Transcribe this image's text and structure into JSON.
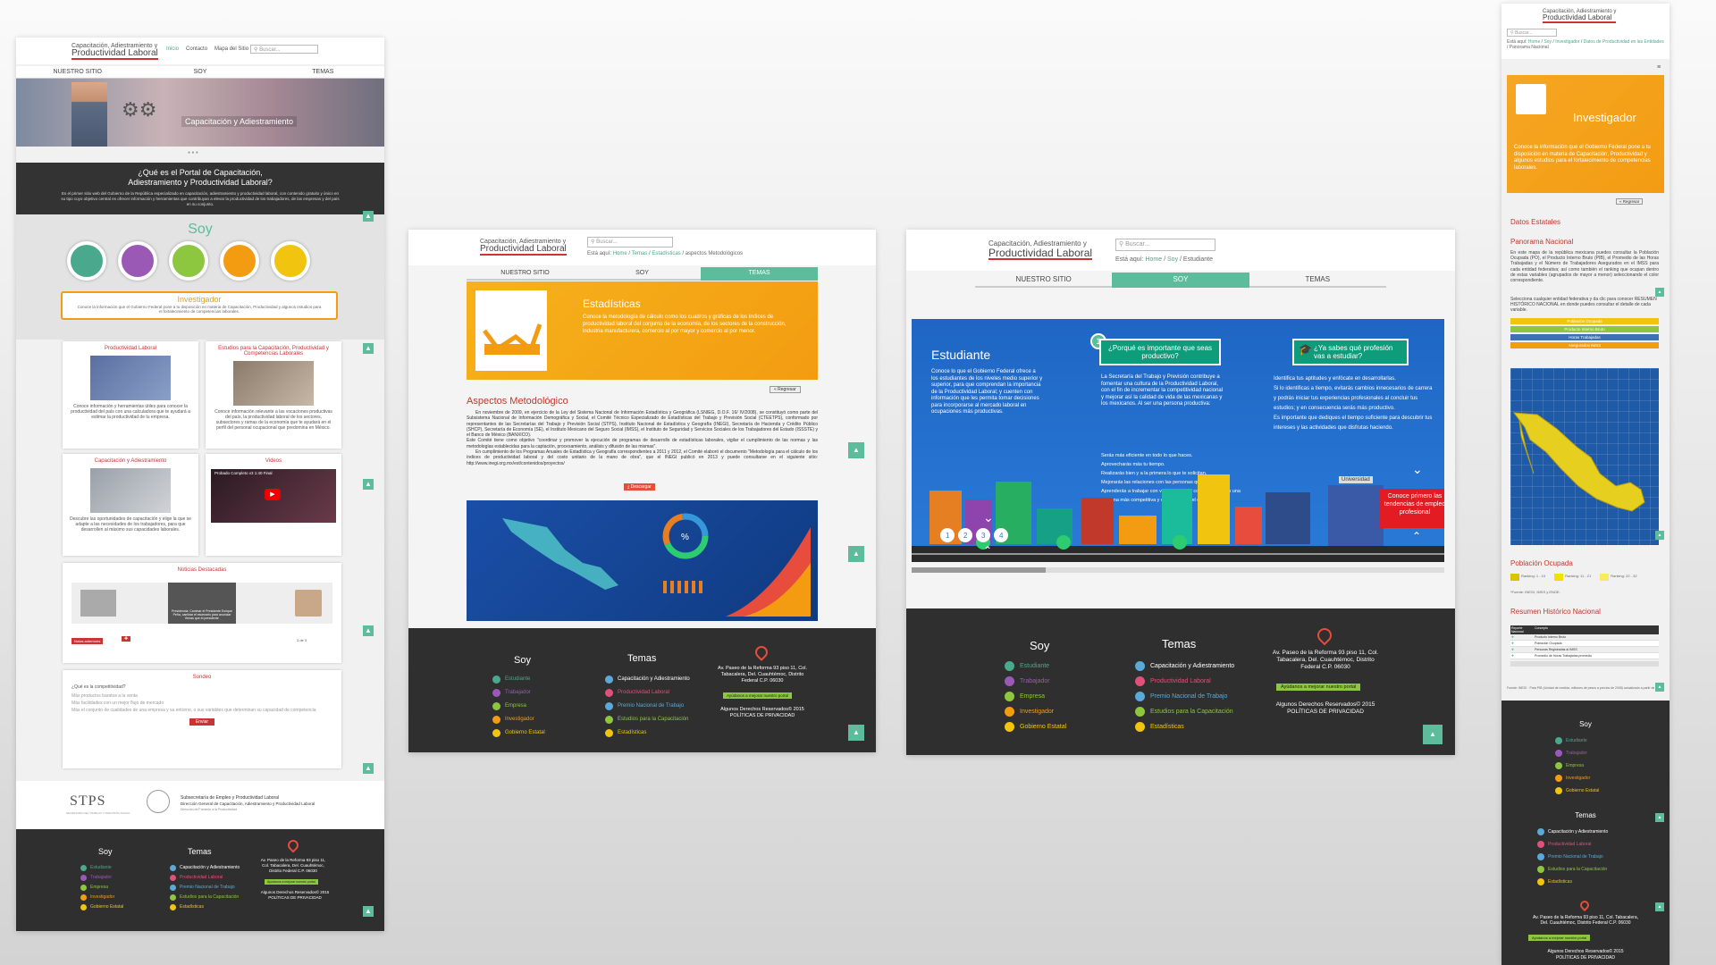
{
  "logo": {
    "line1": "Capacitación, Adiestramiento y",
    "line2": "Productividad Laboral"
  },
  "search_placeholder": "Buscar...",
  "top_nav": [
    "Inicio",
    "Contacto",
    "Mapa del Sitio"
  ],
  "tabs": {
    "home": "NUESTRO SITIO",
    "soy": "SOY",
    "temas": "TEMAS"
  },
  "breadcrumb_label": "Está aquí:",
  "m1": {
    "hero_caption": "Capacitación y Adiestramiento",
    "question_title": "¿Qué es el Portal de Capacitación, Adiestramiento y Productividad Laboral?",
    "question_body": "Es el primer sitio web del Gobierno de la República especializado en capacitación, adiestramiento y productividad laboral, con contenido gratuito y único en su tipo cuyo objetivo central es ofrecer información y herramientas que contribuyan a elevar la productividad de los trabajadores, de las empresas y del país en su conjunto.",
    "soy_title": "Soy",
    "soy_circles": [
      {
        "color": "#4aa88d"
      },
      {
        "color": "#9b59b6"
      },
      {
        "color": "#8dc63f"
      },
      {
        "color": "#f39c12"
      },
      {
        "color": "#f1c40f"
      }
    ],
    "profile_title": "Investigador",
    "profile_desc": "Conoce la información que el Gobierno Federal pone a tu disposición en materia de Capacitación, Productividad y algunos estudios para el fortalecimiento de competencias laborales.",
    "cards": [
      {
        "title": "Productividad Laboral",
        "desc": "Conoce información y herramientas útiles para conocer la productividad del país con una calculadora que te ayudará a estimar la productividad de tu empresa."
      },
      {
        "title": "Estudios para la Capacitación, Productividad y Competencias Laborales",
        "desc": "Conoce información relevante a las vocaciones productivas del país, la productividad laboral de los sectores, subsectores y ramas de la economía que te ayudará en el perfil del personal ocupacional que predomina en México."
      },
      {
        "title": "Capacitación y Adiestramiento",
        "desc": "Descubre las oportunidades de capacitación y elige la que se adapte a las necesidades de los trabajadores, para que desarrollen al máximo sus capacidades laborales."
      },
      {
        "title": "Videos",
        "desc": "",
        "video_title": "Probado Completo v3 1:40 Final"
      }
    ],
    "news_title": "Noticias Destacadas",
    "news_more": "Notas anteriores",
    "news_counter": "3 de 3",
    "news_caption": "Presidencia: Caminar el Presidente Enrique Peña, cambiar el escenario para anunciar firmas que el presidente",
    "survey_title": "Sondeo",
    "survey_q": "¿Qué es la competitividad?",
    "survey_opts": [
      "Más productos baratos a la venta",
      "Más facilidades con un mejor flujo de mercado",
      "Más el conjunto de cualidades de una empresa y su entorno, o sus variables que determinan su capacidad de competencia"
    ],
    "survey_btn": "Enviar",
    "stps": "STPS",
    "stps_sub": "SECRETARÍA DEL TRABAJO Y PREVISIÓN SOCIAL",
    "org1": "Subsecretaría de Empleo y Productividad Laboral",
    "org2": "Dirección General de Capacitación, Adiestramiento y Productividad Laboral",
    "org3": "Dirección de Fomento a la Productividad"
  },
  "m2": {
    "breadcrumb": [
      "Home",
      "Temas",
      "Estadísticas",
      "aspectos Metodológicos"
    ],
    "banner_title": "Estadísticas",
    "banner_desc": "Conoce la metodología de cálculo como los cuadros y gráficas de los índices de productividad laboral del conjunto de la economía, de los sectores de la construcción, industria manufacturera, comercio al por mayor y comercio al por menor.",
    "regresar": "« Regresar",
    "section_title": "Aspectos Metodológico",
    "p1": "En noviembre de 2009, en ejercicio de la Ley del Sistema Nacional de Información Estadística y Geográfica (LSNIEG, D.O.F. 16/ IV/2008), se constituyó como parte del Subsistema Nacional de Información Demográfica y Social, el Comité Técnico Especializado de Estadísticas del Trabajo y Previsión Social (CTEETPS), conformado por representantes de las Secretarías del Trabajo y Previsión Social (STPS), Instituto Nacional de Estadística y Geografía (INEGI), Secretaría de Hacienda y Crédito Público (SHCP), Secretaría de Economía (SE), el Instituto Mexicano del Seguro Social (IMSS), el Instituto de Seguridad y Servicios Sociales de los Trabajadores del Estado (ISSSTE) y el Banco de México (BANXICO).",
    "p2": "Este Comité tiene como objetivo \"coordinar y promover la ejecución de programas de desarrollo de estadísticas laborales, vigilar el cumplimiento de las normas y las metodologías establecidas para la captación, procesamiento, análisis y difusión de las mismas\".",
    "p3": "En cumplimiento de los Programas Anuales de Estadística y Geografía correspondientes a 2011 y 2012, el Comité elaboró el documento \"Metodología para el cálculo de los índices de productividad laboral y del costo unitario de la mano de obra\", que el INEGI publicó en 2013 y puede consultarse en el siguiente sitio: http://www.inegi.org.mx/est/contenidos/proyectos/",
    "download_btn": "Descargar",
    "donut_label": "%"
  },
  "m3": {
    "breadcrumb": [
      "Home",
      "Soy",
      "Estudiante"
    ],
    "hero_title": "Estudiante",
    "hero_desc": "Conoce lo que el Gobierno Federal ofrece a los estudiantes de los niveles medio superior y superior, para que comprendan la importancia de la Productividad Laboral; y cuenten con información que les permita tomar decisiones para incorporarse al mercado laboral en ocupaciones más productivas.",
    "step_num": "1",
    "q1": "¿Porqué es importante que seas productivo?",
    "q1_body": "La Secretaría del Trabajo y Previsión contribuye a fomentar una cultura de la Productividad Laboral, con el fin de incrementar la competitividad nacional y mejorar así la calidad de vida de las mexicanas y los mexicanos. Al ser una persona productiva:",
    "q1_list": [
      "Serás más eficiente en todo lo que haces.",
      "Aprovecharás más tu tiempo.",
      "Realizarás bien y a la primera lo que te solicitan.",
      "Mejorarás las relaciones con las personas que te rodean.",
      "Aprenderás a trabajar con valores y ética, convirtiéndote en una persona más competitiva y empleable en el corto plazo."
    ],
    "q2": "¿Ya sabes qué profesión vas a estudiar?",
    "q2_list": [
      "Identifica tus aptitudes y enfócate en desarrollarlas.",
      "Si lo identificas a tiempo, evitarás cambios innecesarios de carrera y podrás iniciar tus experiencias profesionales al concluir tus estudios; y en consecuencia serás más productivo.",
      "Es importante que dediques el tiempo suficiente para descubrir tus intereses y las actividades que disfrutas haciendo."
    ],
    "univ": "Universidad",
    "cta": "Conoce primero las tendencias de empleo profesional",
    "steps": [
      "1",
      "2",
      "3",
      "4"
    ]
  },
  "m4": {
    "breadcrumb": [
      "Home",
      "Soy",
      "Investigador",
      "Datos de Productividad en las Entidades",
      "Panorama Nacional"
    ],
    "banner_title": "Investigador",
    "banner_desc": "Conoce la información que el Gobierno Federal pone a tu disposición en materia de Capacitación, Productividad y algunos estudios para el fortalecimiento de competencias laborales.",
    "regresar": "« Regresar",
    "datos_title": "Datos Estatales",
    "panorama_title": "Panorama Nacional",
    "panorama_body": "En este mapa de la república mexicana puedes consultar la Población Ocupada (PO), el Producto Interno Bruto (PIB), el Promedio de las Horas Trabajadas y el Número de Trabajadores Asegurados en el IMSS para cada entidad federativa; así como también el ranking que ocupan dentro de estas variables (agrupados de mayor a menor) seleccionando el color correspondiente.",
    "instr": "Selecciona cualquier entidad federativa y da clic para conocer RESUMEN HISTÓRICO NACIONAL en donde puedes consultar el detalle de cada variable.",
    "var_buttons": [
      {
        "label": "Población Ocupada",
        "color": "#f1c40f"
      },
      {
        "label": "Producto Interno Bruto",
        "color": "#8dc63f"
      },
      {
        "label": "Horas Trabajadas",
        "color": "#3f6fb5"
      },
      {
        "label": "Asegurados IMSS",
        "color": "#f39c12"
      }
    ],
    "poblacion_title": "Población Ocupada",
    "legend": [
      "Ranking: 1 - 10",
      "Ranking: 11 - 21",
      "Ranking: 22 - 32"
    ],
    "legend_colors": [
      "#d8c400",
      "#f1e000",
      "#f7ec60"
    ],
    "source": "*Fuente: INEGI, IMSS y ENOE.",
    "resumen_title": "Resumen Histórico Nacional",
    "table_headers": [
      "Reporte Nacional",
      "Concepto",
      ""
    ],
    "table_rows": [
      "Producto Interno Bruto",
      "Población Ocupada",
      "Personas Registradas al IMSS",
      "Promedio de Horas Trabajadas promedio"
    ],
    "table_note": "Fuente: INEGI  ·  Para PIB (Unidad de medida, millones de pesos a precios de 2008) actualizado a partir de 2013"
  },
  "footer": {
    "soy_title": "Soy",
    "soy_items": [
      {
        "label": "Estudiante",
        "color": "#4aa88d"
      },
      {
        "label": "Trabajador",
        "color": "#9b59b6"
      },
      {
        "label": "Empresa",
        "color": "#8dc63f"
      },
      {
        "label": "Investigador",
        "color": "#f39c12"
      },
      {
        "label": "Gobierno Estatal",
        "color": "#f1c40f"
      }
    ],
    "temas_title": "Temas",
    "temas_items": [
      {
        "label": "Capacitación y Adiestramiento",
        "color": "#ffffff"
      },
      {
        "label": "Productividad Laboral",
        "color": "#e0507a"
      },
      {
        "label": "Premio Nacional de Trabajo",
        "color": "#5aa9d6"
      },
      {
        "label": "Estudios para la Capacitación",
        "color": "#8dc63f"
      },
      {
        "label": "Estadísticas",
        "color": "#f1c40f"
      }
    ],
    "address": "Av. Paseo de la Reforma 93 piso 11, Col. Tabacalera, Del. Cuauhtémoc, Distrito Federal C.P. 06030",
    "improve_btn": "Ayúdanos a mejorar nuestro portal",
    "rights": "Algunos Derechos Reservados© 2015",
    "privacy": "POLÍTICAS DE PRIVACIDAD"
  },
  "colors": {
    "teal": "#5cbc9c",
    "dark": "#2f2f2f",
    "orange": "#f39c12",
    "red": "#c0392b",
    "blue": "#1f66c4"
  }
}
